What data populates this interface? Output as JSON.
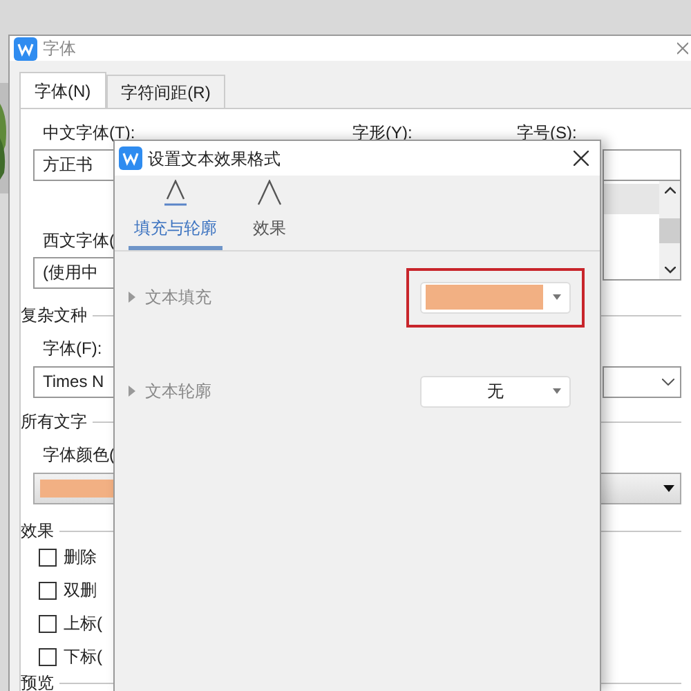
{
  "back_dialog": {
    "title": "字体",
    "tabs": [
      {
        "label": "字体(N)",
        "selected": true
      },
      {
        "label": "字符间距(R)",
        "selected": false
      }
    ],
    "chinese_font": {
      "label": "中文字体(T):",
      "value": "方正书"
    },
    "style_label": "字形(Y):",
    "size_label": "字号(S):",
    "western_font": {
      "label": "西文字体(",
      "value": "(使用中"
    },
    "complex_section": "复杂文种",
    "complex_font": {
      "label": "字体(F):",
      "value": "Times N"
    },
    "all_text_section": "所有文字",
    "font_color": {
      "label": "字体颜色(",
      "color": "#f2b083"
    },
    "effects_section": "效果",
    "effects": [
      {
        "label": "删除",
        "checked": false
      },
      {
        "label": "双删",
        "checked": false
      },
      {
        "label": "上标(",
        "checked": false
      },
      {
        "label": "下标(",
        "checked": false
      }
    ],
    "preview_section": "预览"
  },
  "front_dialog": {
    "title": "设置文本效果格式",
    "tabs": [
      {
        "label": "填充与轮廓",
        "selected": true
      },
      {
        "label": "效果",
        "selected": false
      }
    ],
    "rows": [
      {
        "kind": "color",
        "label": "文本填充",
        "color": "#f2b083",
        "highlighted": true
      },
      {
        "kind": "text",
        "label": "文本轮廓",
        "value": "无",
        "highlighted": false
      }
    ]
  }
}
